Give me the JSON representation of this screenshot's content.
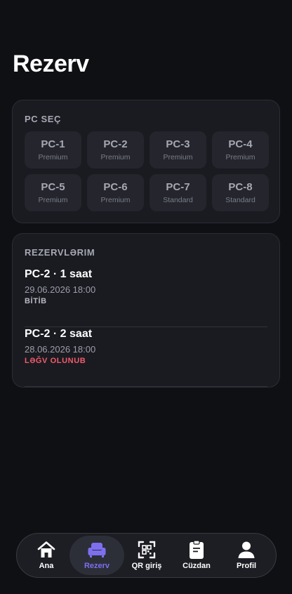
{
  "header": {
    "title": "Rezerv"
  },
  "pc_select": {
    "title": "PC SEÇ",
    "items": [
      {
        "name": "PC-1",
        "tier": "Premium"
      },
      {
        "name": "PC-2",
        "tier": "Premium"
      },
      {
        "name": "PC-3",
        "tier": "Premium"
      },
      {
        "name": "PC-4",
        "tier": "Premium"
      },
      {
        "name": "PC-5",
        "tier": "Premium"
      },
      {
        "name": "PC-6",
        "tier": "Premium"
      },
      {
        "name": "PC-7",
        "tier": "Standard"
      },
      {
        "name": "PC-8",
        "tier": "Standard"
      }
    ]
  },
  "reservations": {
    "title": "REZERVLƏRIM",
    "items": [
      {
        "title": "PC-2 · 1 saat",
        "datetime": "29.06.2026 18:00",
        "status": "BİTİB"
      },
      {
        "title": "PC-2 · 2 saat",
        "datetime": "28.06.2026 18:00",
        "status": "LƏĞV OLUNUB"
      }
    ]
  },
  "colors": {
    "accent": "#7d6ff0",
    "status_cancelled": "#f25c6b",
    "background": "#0f1014",
    "card": "#1a1b21"
  },
  "nav": {
    "items": [
      {
        "label": "Ana",
        "icon": "home-icon"
      },
      {
        "label": "Rezerv",
        "icon": "sofa-icon",
        "active": true
      },
      {
        "label": "QR giriş",
        "icon": "qr-scan-icon"
      },
      {
        "label": "Cüzdan",
        "icon": "clipboard-icon"
      },
      {
        "label": "Profil",
        "icon": "user-icon"
      }
    ]
  }
}
